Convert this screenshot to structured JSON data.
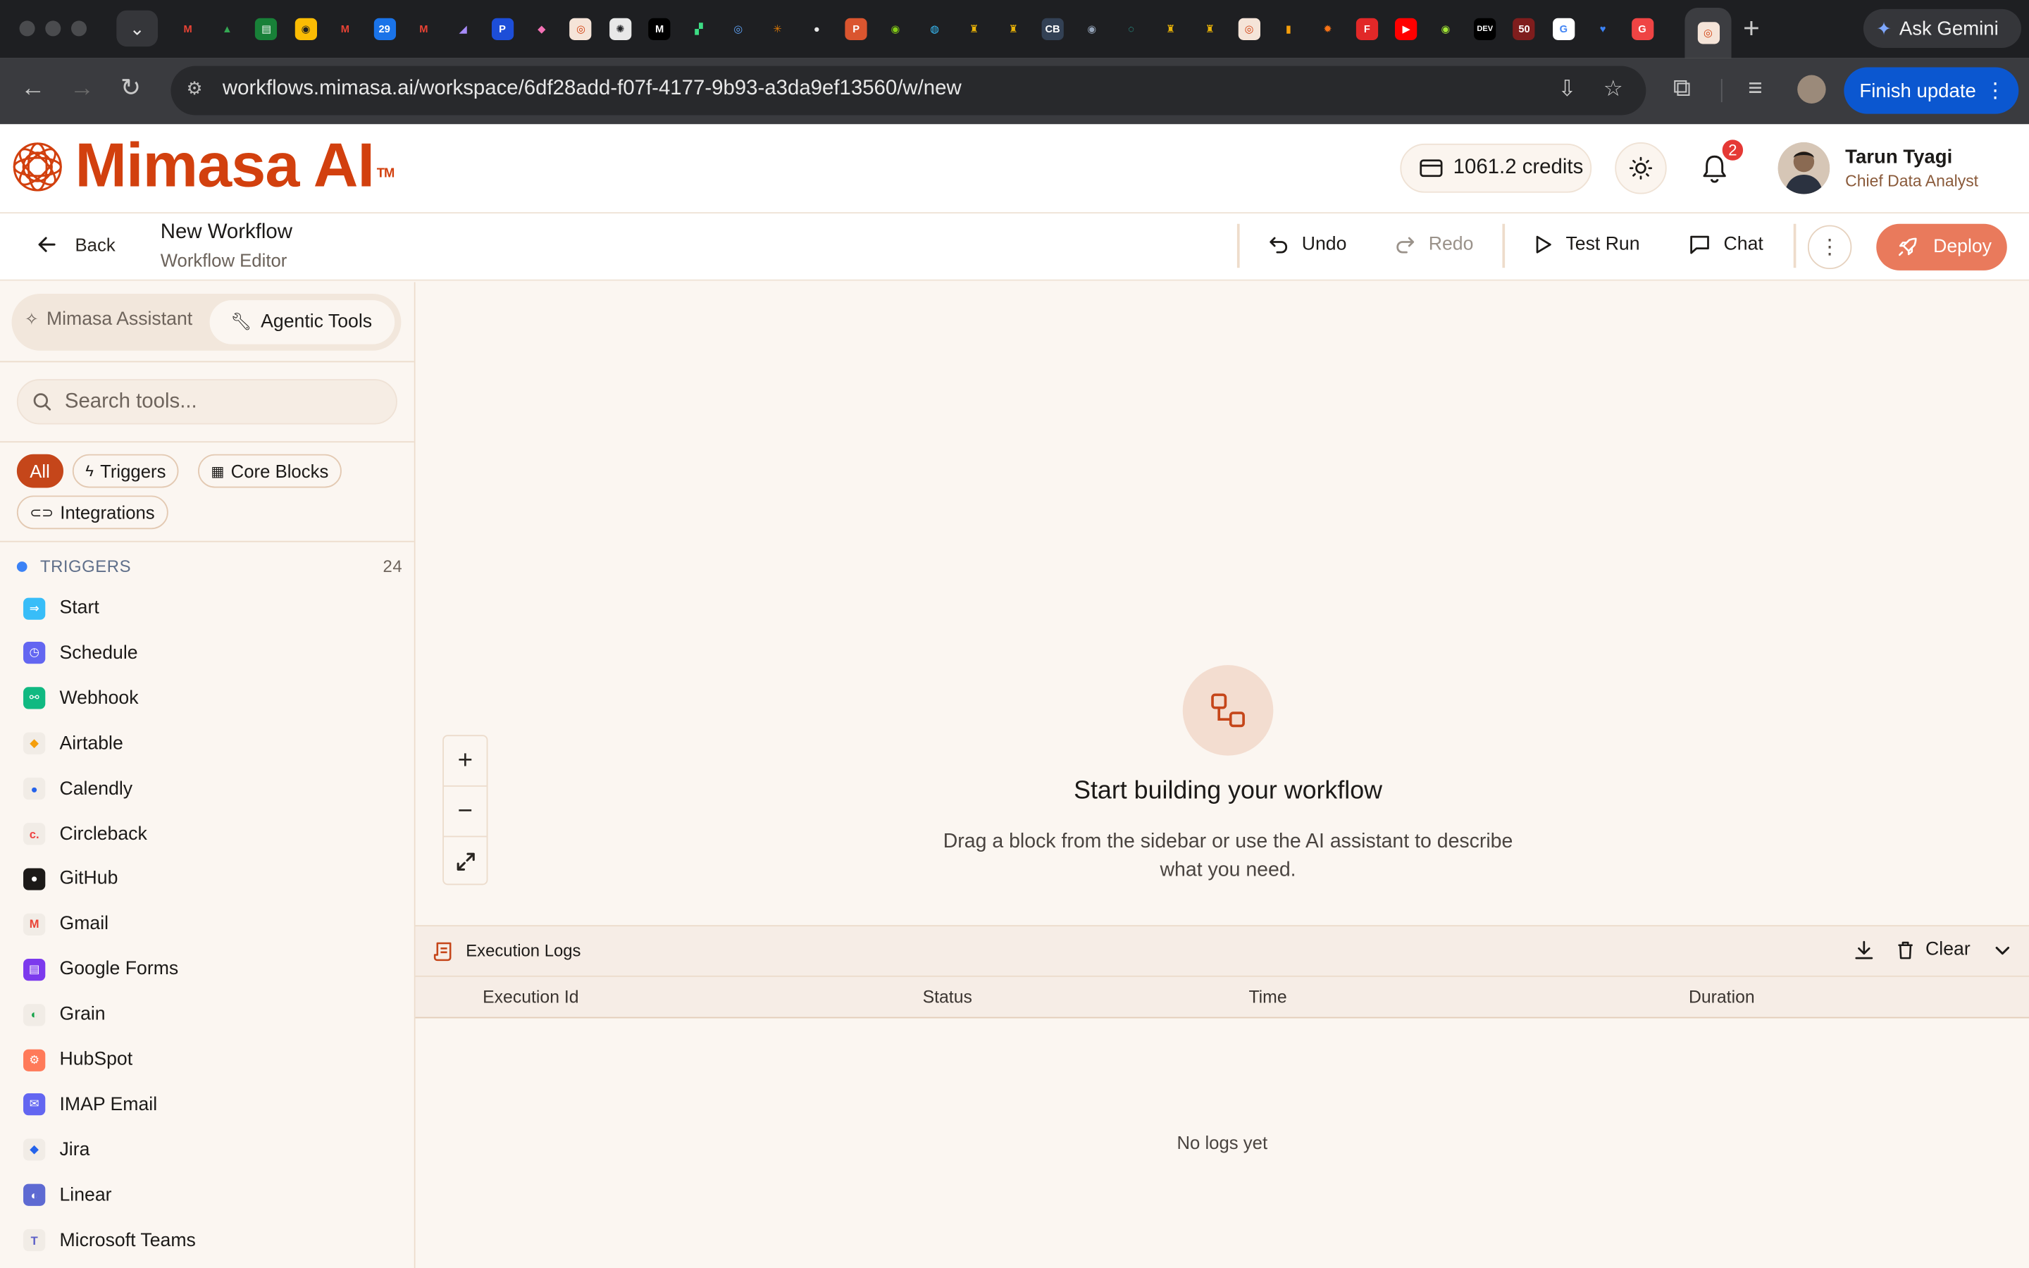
{
  "browser": {
    "url": "workflows.mimasa.ai/workspace/6df28add-f07f-4177-9b93-a3da9ef13560/w/new",
    "ask_gemini": "Ask Gemini",
    "finish_update": "Finish update",
    "favicons": [
      {
        "name": "gmail",
        "glyph": "M",
        "color": "#ea4335",
        "bg": "transparent"
      },
      {
        "name": "drive",
        "glyph": "▲",
        "color": "#34a853",
        "bg": "transparent"
      },
      {
        "name": "sheets",
        "glyph": "▤",
        "color": "#fff",
        "bg": "#188038"
      },
      {
        "name": "keep",
        "glyph": "◉",
        "color": "#1e1f22",
        "bg": "#fbbc04"
      },
      {
        "name": "gmail",
        "glyph": "M",
        "color": "#ea4335",
        "bg": "transparent"
      },
      {
        "name": "calendar",
        "glyph": "29",
        "color": "#fff",
        "bg": "#1a73e8"
      },
      {
        "name": "gmail",
        "glyph": "M",
        "color": "#ea4335",
        "bg": "transparent"
      },
      {
        "name": "app",
        "glyph": "◢",
        "color": "#a78bfa",
        "bg": "transparent"
      },
      {
        "name": "app",
        "glyph": "P",
        "color": "#fff",
        "bg": "#1d4ed8"
      },
      {
        "name": "app",
        "glyph": "◆",
        "color": "#f472b6",
        "bg": "transparent"
      },
      {
        "name": "mimasa",
        "glyph": "◎",
        "color": "#d2400e",
        "bg": "#f5e4d8"
      },
      {
        "name": "openai",
        "glyph": "✺",
        "color": "#1e1f22",
        "bg": "#e8e8e8"
      },
      {
        "name": "medium",
        "glyph": "M",
        "color": "#fff",
        "bg": "#000"
      },
      {
        "name": "app",
        "glyph": "▞",
        "color": "#3ddc84",
        "bg": "transparent"
      },
      {
        "name": "app",
        "glyph": "◎",
        "color": "#60a5fa",
        "bg": "transparent"
      },
      {
        "name": "claude",
        "glyph": "✳",
        "color": "#d97706",
        "bg": "transparent"
      },
      {
        "name": "github",
        "glyph": "●",
        "color": "#e8e8e8",
        "bg": "transparent"
      },
      {
        "name": "product-hunt",
        "glyph": "P",
        "color": "#fff",
        "bg": "#da552f"
      },
      {
        "name": "app",
        "glyph": "◉",
        "color": "#84cc16",
        "bg": "transparent"
      },
      {
        "name": "app",
        "glyph": "◍",
        "color": "#38bdf8",
        "bg": "transparent"
      },
      {
        "name": "app",
        "glyph": "♜",
        "color": "#eab308",
        "bg": "transparent"
      },
      {
        "name": "app",
        "glyph": "♜",
        "color": "#eab308",
        "bg": "transparent"
      },
      {
        "name": "cb",
        "glyph": "CB",
        "color": "#fff",
        "bg": "#334155"
      },
      {
        "name": "app",
        "glyph": "◉",
        "color": "#94a3b8",
        "bg": "transparent"
      },
      {
        "name": "app",
        "glyph": "◌",
        "color": "#2dd4bf",
        "bg": "transparent"
      },
      {
        "name": "app",
        "glyph": "♜",
        "color": "#eab308",
        "bg": "transparent"
      },
      {
        "name": "app",
        "glyph": "♜",
        "color": "#eab308",
        "bg": "transparent"
      },
      {
        "name": "mimasa",
        "glyph": "◎",
        "color": "#d2400e",
        "bg": "#f5e4d8"
      },
      {
        "name": "analytics",
        "glyph": "▮",
        "color": "#f59e0b",
        "bg": "transparent"
      },
      {
        "name": "app",
        "glyph": "✹",
        "color": "#f97316",
        "bg": "transparent"
      },
      {
        "name": "flipboard",
        "glyph": "F",
        "color": "#fff",
        "bg": "#e12828"
      },
      {
        "name": "youtube",
        "glyph": "▶",
        "color": "#fff",
        "bg": "#ff0000"
      },
      {
        "name": "app",
        "glyph": "◉",
        "color": "#a3e635",
        "bg": "transparent"
      },
      {
        "name": "dev",
        "glyph": "DEV",
        "color": "#fff",
        "bg": "#000"
      },
      {
        "name": "app",
        "glyph": "50",
        "color": "#fff",
        "bg": "#7f1d1d"
      },
      {
        "name": "google",
        "glyph": "G",
        "color": "#4285f4",
        "bg": "#fff"
      },
      {
        "name": "app",
        "glyph": "♥",
        "color": "#3b82f6",
        "bg": "transparent"
      },
      {
        "name": "app",
        "glyph": "G",
        "color": "#fff",
        "bg": "#ef4444"
      }
    ]
  },
  "app": {
    "brand": "Mimasa AI",
    "trademark": "TM",
    "credits": "1061.2 credits",
    "notifications": "2",
    "user_name": "Tarun Tyagi",
    "user_role": "Chief Data Analyst"
  },
  "toolbar": {
    "back": "Back",
    "title": "New Workflow",
    "subtitle": "Workflow Editor",
    "undo": "Undo",
    "redo": "Redo",
    "test_run": "Test Run",
    "chat": "Chat",
    "deploy": "Deploy"
  },
  "sidebar": {
    "tab_assistant": "Mimasa Assistant",
    "tab_tools": "Agentic Tools",
    "search_placeholder": "Search tools...",
    "filters": {
      "all": "All",
      "triggers": "Triggers",
      "core_blocks": "Core Blocks",
      "integrations": "Integrations"
    },
    "section_title": "TRIGGERS",
    "section_count": "24",
    "items": [
      {
        "label": "Start",
        "icon": "start-icon",
        "glyph": "⇒",
        "bg": "#38bdf8",
        "fg": "#fff"
      },
      {
        "label": "Schedule",
        "icon": "clock-icon",
        "glyph": "◷",
        "bg": "#6366f1",
        "fg": "#fff"
      },
      {
        "label": "Webhook",
        "icon": "webhook-icon",
        "glyph": "⚯",
        "bg": "#10b981",
        "fg": "#fff"
      },
      {
        "label": "Airtable",
        "icon": "airtable-icon",
        "glyph": "◆",
        "bg": "#f1ece6",
        "fg": "#f59e0b"
      },
      {
        "label": "Calendly",
        "icon": "calendly-icon",
        "glyph": "●",
        "bg": "#f1ece6",
        "fg": "#2563eb"
      },
      {
        "label": "Circleback",
        "icon": "circleback-icon",
        "glyph": "c.",
        "bg": "#f1ece6",
        "fg": "#ef4444"
      },
      {
        "label": "GitHub",
        "icon": "github-icon",
        "glyph": "●",
        "bg": "#1c1a18",
        "fg": "#fff"
      },
      {
        "label": "Gmail",
        "icon": "gmail-icon",
        "glyph": "M",
        "bg": "#f1ece6",
        "fg": "#ea4335"
      },
      {
        "label": "Google Forms",
        "icon": "google-forms-icon",
        "glyph": "▤",
        "bg": "#7c3aed",
        "fg": "#fff"
      },
      {
        "label": "Grain",
        "icon": "grain-icon",
        "glyph": "◐",
        "bg": "#f1ece6",
        "fg": "#16a34a"
      },
      {
        "label": "HubSpot",
        "icon": "hubspot-icon",
        "glyph": "⚙",
        "bg": "#ff7a59",
        "fg": "#fff"
      },
      {
        "label": "IMAP Email",
        "icon": "mail-icon",
        "glyph": "✉",
        "bg": "#6366f1",
        "fg": "#fff"
      },
      {
        "label": "Jira",
        "icon": "jira-icon",
        "glyph": "◆",
        "bg": "#f1ece6",
        "fg": "#2563eb"
      },
      {
        "label": "Linear",
        "icon": "linear-icon",
        "glyph": "◐",
        "bg": "#5e6ad2",
        "fg": "#fff"
      },
      {
        "label": "Microsoft Teams",
        "icon": "teams-icon",
        "glyph": "T",
        "bg": "#f1ece6",
        "fg": "#5b5fc7"
      }
    ]
  },
  "canvas": {
    "empty_title": "Start building your workflow",
    "empty_desc": "Drag a block from the sidebar or use the AI assistant to describe what you need."
  },
  "logs": {
    "title": "Execution Logs",
    "clear": "Clear",
    "columns": [
      "Execution Id",
      "Status",
      "Time",
      "Duration"
    ],
    "empty": "No logs yet"
  },
  "colors": {
    "brand": "#d2400e",
    "deploy": "#e97a5c",
    "chip_active": "#c5461a"
  }
}
